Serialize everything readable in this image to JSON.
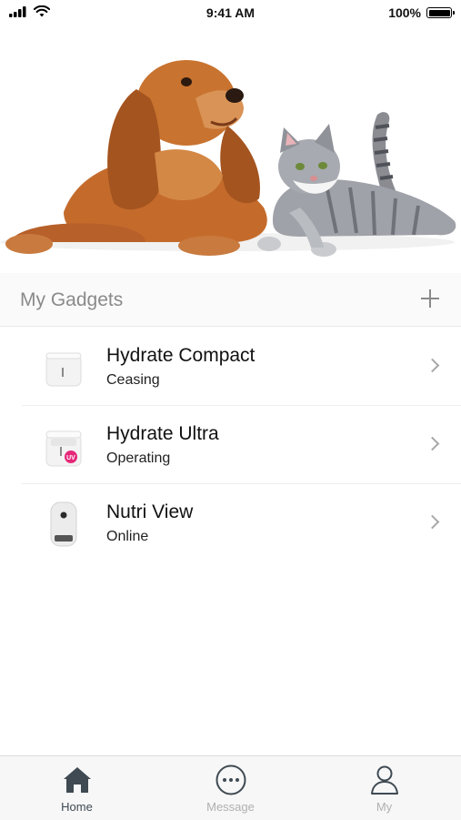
{
  "status_bar": {
    "time": "9:41 AM",
    "battery_text": "100%",
    "battery_level": 1.0,
    "icons": [
      "signal-icon",
      "wifi-icon",
      "battery-icon"
    ]
  },
  "hero": {
    "image": "dog-and-cat-photo"
  },
  "gadgets": {
    "title": "My Gadgets",
    "add_icon": "plus-icon",
    "items": [
      {
        "name": "Hydrate Compact",
        "status": "Ceasing",
        "icon": "water-fountain-compact-icon"
      },
      {
        "name": "Hydrate Ultra",
        "status": "Operating",
        "icon": "water-fountain-ultra-icon",
        "badge": "UV"
      },
      {
        "name": "Nutri View",
        "status": "Online",
        "icon": "feeder-camera-icon"
      }
    ]
  },
  "tab_bar": {
    "tabs": [
      {
        "label": "Home",
        "icon": "home-icon",
        "active": true
      },
      {
        "label": "Message",
        "icon": "message-icon",
        "active": false
      },
      {
        "label": "My",
        "icon": "profile-icon",
        "active": false
      }
    ]
  },
  "colors": {
    "active_tab": "#3f4a52",
    "inactive_tab": "#b0b0b0",
    "section_bg": "#fafafa",
    "uv_badge": "#e6287a"
  }
}
